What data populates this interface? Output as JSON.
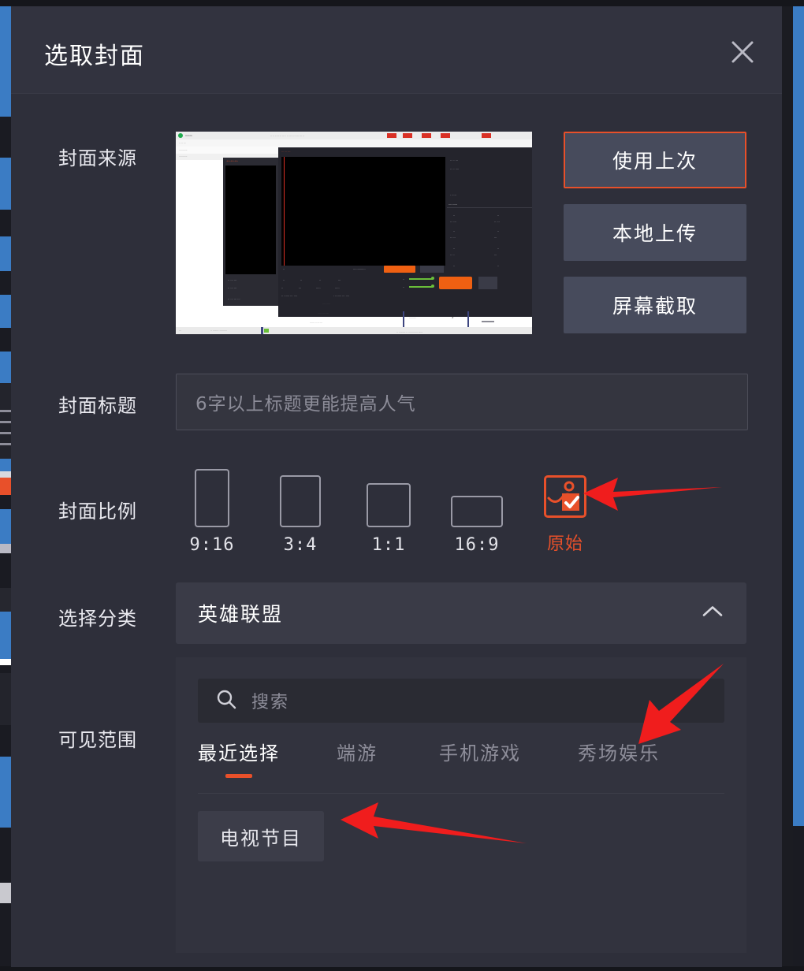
{
  "dialog": {
    "title": "选取封面",
    "close_icon": "close-icon"
  },
  "cover_source": {
    "label": "封面来源",
    "buttons": [
      {
        "label": "使用上次",
        "selected": true
      },
      {
        "label": "本地上传",
        "selected": false
      },
      {
        "label": "屏幕截取",
        "selected": false
      }
    ],
    "thumbnail_alt": "直播推流软件界面截图"
  },
  "cover_title": {
    "label": "封面标题",
    "value": "",
    "placeholder": "6字以上标题更能提高人气"
  },
  "cover_ratio": {
    "label": "封面比例",
    "options": [
      {
        "caption": "9:16",
        "selected": false
      },
      {
        "caption": "3:4",
        "selected": false
      },
      {
        "caption": "1:1",
        "selected": false
      },
      {
        "caption": "16:9",
        "selected": false
      },
      {
        "caption": "原始",
        "selected": true,
        "icon": "image-check-icon"
      }
    ]
  },
  "category": {
    "label": "选择分类",
    "selected_value": "英雄联盟",
    "chevron_icon": "chevron-up-icon",
    "expanded": true
  },
  "visibility": {
    "label": "可见范围"
  },
  "dropdown": {
    "search": {
      "placeholder": "搜索",
      "value": "",
      "icon": "search-icon"
    },
    "tabs": [
      {
        "label": "最近选择",
        "active": true
      },
      {
        "label": "端游",
        "active": false
      },
      {
        "label": "手机游戏",
        "active": false
      },
      {
        "label": "秀场娱乐",
        "active": false
      }
    ],
    "results": [
      {
        "label": "电视节目"
      }
    ]
  },
  "annotations": {
    "arrow_ratio": "red-arrow-left",
    "arrow_tabs": "red-arrow-diagonal",
    "arrow_result": "red-arrow-left"
  },
  "colors": {
    "accent": "#e8502a",
    "dialog_bg": "#2e2f3a",
    "titlebar_bg": "#32333f",
    "button_bg": "#474b5c",
    "dropdown_bg": "#32333e",
    "annotation": "#f01d1d",
    "edge_blue": "#3b7cc4"
  }
}
